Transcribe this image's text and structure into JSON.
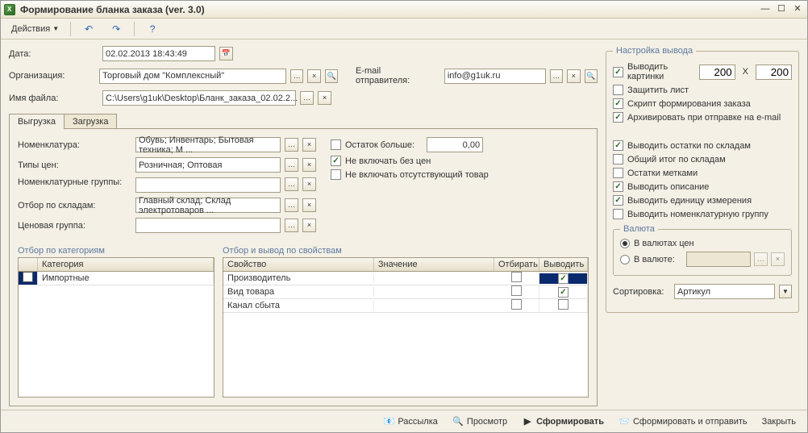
{
  "window": {
    "title": "Формирование бланка заказа (ver. 3.0)"
  },
  "toolbar": {
    "actions": "Действия"
  },
  "fields": {
    "date_label": "Дата:",
    "date_value": "02.02.2013 18:43:49",
    "org_label": "Организация:",
    "org_value": "Торговый дом \"Комплексный\"",
    "email_label": "E-mail отправителя:",
    "email_value": "info@g1uk.ru",
    "filename_label": "Имя файла:",
    "filename_value": "C:\\Users\\g1uk\\Desktop\\Бланк_заказа_02.02.2..."
  },
  "tabs": {
    "tab1": "Выгрузка",
    "tab2": "Загрузка"
  },
  "filters": {
    "nomen_label": "Номенклатура:",
    "nomen_value": "Обувь; Инвентарь; Бытовая техника; М ...",
    "price_types_label": "Типы цен:",
    "price_types_value": "Розничная; Оптовая",
    "nomen_groups_label": "Номенклатурные группы:",
    "nomen_groups_value": "",
    "warehouse_label": "Отбор по складам:",
    "warehouse_value": "Главный склад; Склад электротоваров ...",
    "price_group_label": "Ценовая группа:",
    "price_group_value": "",
    "stock_gt": "Остаток больше:",
    "stock_gt_value": "0,00",
    "exclude_no_price": "Не включать без цен",
    "exclude_missing": "Не включать отсутствующий товар"
  },
  "cat_section": {
    "title": "Отбор по категориям",
    "col_check": "",
    "col_name": "Категория",
    "rows": [
      {
        "checked": false,
        "name": "Импортные"
      }
    ]
  },
  "prop_section": {
    "title": "Отбор и вывод по свойствам",
    "col_prop": "Свойство",
    "col_val": "Значение",
    "col_sel": "Отбирать",
    "col_out": "Выводить",
    "rows": [
      {
        "prop": "Производитель",
        "val": "",
        "sel": false,
        "out": true
      },
      {
        "prop": "Вид товара",
        "val": "",
        "sel": false,
        "out": true
      },
      {
        "prop": "Канал сбыта",
        "val": "",
        "sel": false,
        "out": false
      }
    ]
  },
  "output": {
    "group_title": "Настройка вывода",
    "show_images": "Выводить картинки",
    "img_w": "200",
    "img_x": "X",
    "img_h": "200",
    "protect_sheet": "Защитить лист",
    "form_script": "Скрипт формирования заказа",
    "zip_email": "Архивировать при отправке на e-mail",
    "stocks_by_wh": "Выводить остатки по складам",
    "totals_by_wh": "Общий итог по складам",
    "stocks_tags": "Остатки метками",
    "show_desc": "Выводить описание",
    "show_unit": "Выводить единицу измерения",
    "show_group": "Выводить номенклатурную группу",
    "currency_group": "Валюта",
    "in_price_currencies": "В валютах цен",
    "in_currency": "В валюте:",
    "sort_label": "Сортировка:",
    "sort_value": "Артикул"
  },
  "bottom": {
    "mailing": "Рассылка",
    "preview": "Просмотр",
    "form": "Сформировать",
    "form_send": "Сформировать и отправить",
    "close": "Закрыть"
  }
}
